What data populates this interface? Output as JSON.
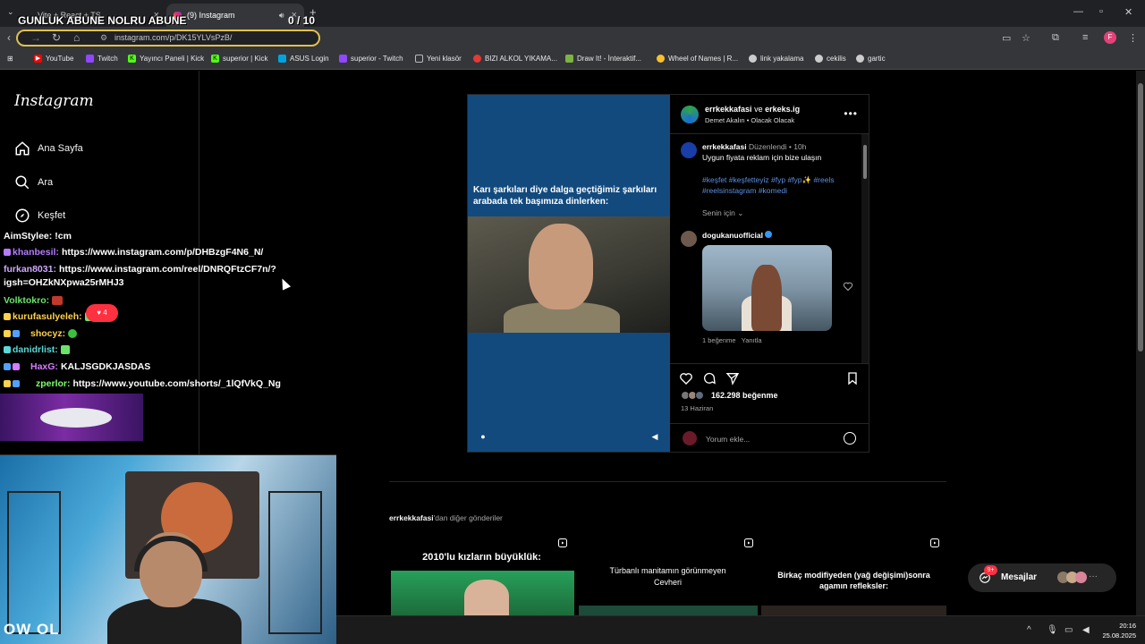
{
  "browser": {
    "tabs": [
      {
        "label": "Vite + React + TS",
        "active": false
      },
      {
        "label": "(9) Instagram",
        "active": true
      }
    ],
    "url": "instagram.com/p/DK15YLVsPzB/",
    "bookmarks": [
      {
        "label": "YouTube",
        "color": "#ff0000"
      },
      {
        "label": "Twitch",
        "color": "#9146ff"
      },
      {
        "label": "Yayıncı Paneli | Kick",
        "color": "#53fc18"
      },
      {
        "label": "superior | Kick",
        "color": "#53fc18"
      },
      {
        "label": "ASUS Login",
        "color": "#00a3e0"
      },
      {
        "label": "superior - Twitch",
        "color": "#9146ff"
      },
      {
        "label": "Yeni klasör",
        "color": "#8a8a8a"
      },
      {
        "label": "BIZI ALKOL YIKAMA...",
        "color": "#e53935"
      },
      {
        "label": "Draw It! - İnteraktif...",
        "color": "#7cb342"
      },
      {
        "label": "Wheel of Names | R...",
        "color": "#fbc02d"
      },
      {
        "label": "link yakalama",
        "color": "#cccccc"
      },
      {
        "label": "cekilis",
        "color": "#cccccc"
      },
      {
        "label": "gartic",
        "color": "#cccccc"
      }
    ]
  },
  "overlay": {
    "title": "GUNLUK ABUNE NOLRU ABUNE",
    "counter": "0  / 10",
    "cam_logo": "OW OL"
  },
  "instagram": {
    "logo": "Instagram",
    "nav": [
      "Ana Sayfa",
      "Ara",
      "Keşfet"
    ],
    "post": {
      "image_caption": "Karı şarkıları diye dalga geçtiğimiz şarkıları arabada tek başımıza dinlerken:",
      "header_user1": "errkekkafasi",
      "header_and": "ve",
      "header_user2": "erkeks.ig",
      "header_sub": "Demet Akalın • Olacak Olacak",
      "author": "errkekkafasi",
      "edited": "Düzenlendi • 10h",
      "caption": "Uygun fiyata reklam için bize ulaşın",
      "hashtags": "#keşfet #keşfetteyiz #fyp #fyp✨ #reels #reelsinstagram #komedi",
      "for_you": "Senin için",
      "commenter": "dogukanuofficial",
      "comment_likes": "1 beğenme",
      "reply": "Yanıtla",
      "likes": "162.298 beğenme",
      "date": "13 Haziran",
      "comment_placeholder": "Yorum ekle..."
    },
    "more_posts": {
      "user": "errkekkafasi",
      "suffix": "'dan diğer gönderiler",
      "items": [
        "2010'lu kızların büyüklük:",
        "Türbanlı manitamın görünmeyen Cevheri",
        "Birkaç modifiyeden (yağ değişimi)sonra agamın refleksler:"
      ]
    },
    "messages": {
      "label": "Mesajlar",
      "badge": "9+"
    }
  },
  "chat": [
    {
      "user": "AimStylee:",
      "msg": "!cm",
      "color": "#ffffff"
    },
    {
      "user": "khanbesil:",
      "msg": "https://www.instagram.com/p/DHBzgF4N6_N/",
      "color": "#b57cff"
    },
    {
      "user": "furkan8031:",
      "msg": "https://www.instagram.com/reel/DNRQFtzCF7n/?",
      "color": "#cfa8ff"
    },
    {
      "user": "",
      "msg": "igsh=OHZkNXpwa25rMHJ3",
      "color": "#ffffff"
    },
    {
      "user": "Volktokro:",
      "msg": "",
      "color": "#6be36b"
    },
    {
      "user": "kurufasulyeleh:",
      "msg": "",
      "color": "#ffd24a"
    },
    {
      "user": "shocyz:",
      "msg": "",
      "color": "#ffd24a"
    },
    {
      "user": "danidrlist:",
      "msg": "",
      "color": "#5ad7d7"
    },
    {
      "user": "HaxG:",
      "msg": "KALJSGDKJASDAS",
      "color": "#d67cff"
    },
    {
      "user": "zperlor:",
      "msg": "https://www.youtube.com/shorts/_1lQfVkQ_Ng",
      "color": "#7cff6b"
    }
  ],
  "notif_badge": "4",
  "taskbar": {
    "time": "20:16",
    "date": "25.08.2025"
  }
}
